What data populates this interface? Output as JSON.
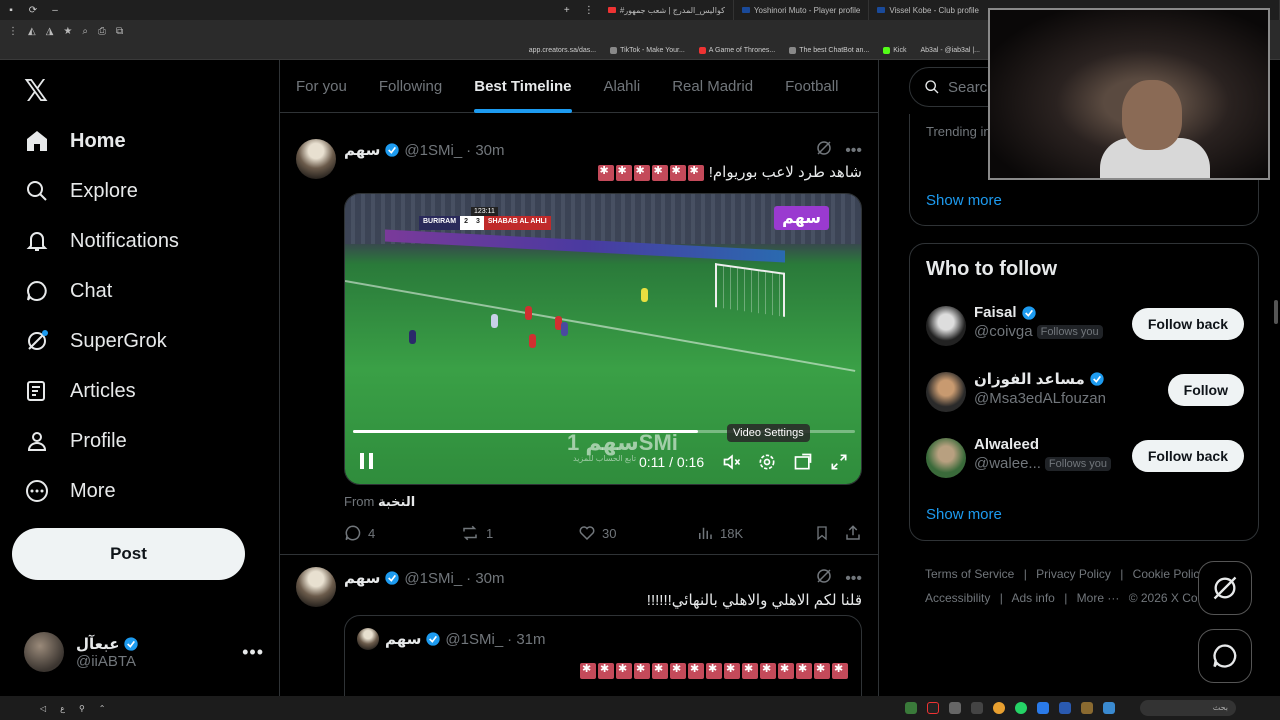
{
  "browser": {
    "tabs": [
      {
        "label": "#كواليس_المدرج | شعب جمهور"
      },
      {
        "label": "Yoshinori Muto - Player profile"
      },
      {
        "label": "Vissel Kobe - Club profile"
      }
    ],
    "bookmarks": [
      {
        "label": "app.creators.sa/das..."
      },
      {
        "label": "TikTok - Make Your..."
      },
      {
        "label": "A Game of Thrones..."
      },
      {
        "label": "The best ChatBot an..."
      },
      {
        "label": "Kick"
      },
      {
        "label": "Ab3al - @iab3al |..."
      }
    ]
  },
  "nav": {
    "items": [
      {
        "label": "Home",
        "icon": "home-icon"
      },
      {
        "label": "Explore",
        "icon": "search-icon"
      },
      {
        "label": "Notifications",
        "icon": "bell-icon"
      },
      {
        "label": "Chat",
        "icon": "chat-icon"
      },
      {
        "label": "SuperGrok",
        "icon": "grok-icon"
      },
      {
        "label": "Articles",
        "icon": "article-icon"
      },
      {
        "label": "Profile",
        "icon": "person-icon"
      },
      {
        "label": "More",
        "icon": "more-circle-icon"
      }
    ],
    "post_label": "Post",
    "account": {
      "name": "عبعآل",
      "handle": "@iiABTA"
    }
  },
  "timeline": {
    "tabs": [
      "For you",
      "Following",
      "Best Timeline",
      "Alahli",
      "Real Madrid",
      "Football"
    ],
    "active_tab": "Best Timeline"
  },
  "tweet1": {
    "name": "سهم",
    "handle": "@1SMi_",
    "time": "· 30m",
    "text": "شاهد طرد لاعب بوريوام!",
    "emoji_count": 6,
    "video": {
      "brand": "سهم",
      "watermark": "سهم 1SMi",
      "watermark_sub": "تابع الحساب للمزيد",
      "score": {
        "team_a": "BURIRAM",
        "score_a": "2",
        "score_b": "3",
        "team_b": "SHABAB AL AHLI",
        "clock": "123:11"
      },
      "progress": 0.6875,
      "time": "0:11 / 0:16",
      "tooltip": "Video Settings"
    },
    "from_prefix": "From",
    "from_source": "النخبة",
    "stats": {
      "replies": "4",
      "reposts": "1",
      "likes": "30",
      "views": "18K"
    }
  },
  "tweet2": {
    "name": "سهم",
    "handle": "@1SMi_",
    "time": "· 30m",
    "text": "قلنا لكم الاهلي والاهلي بالنهائي!!!!!!",
    "quote": {
      "name": "سهم",
      "handle": "@1SMi_",
      "time": "· 31m",
      "emoji_count": 15
    }
  },
  "sidebar": {
    "search_placeholder": "Search",
    "trending_label": "Trending in",
    "show_more": "Show more",
    "who_to_follow_title": "Who to follow",
    "who_to_follow": [
      {
        "name": "Faisal",
        "handle": "@coivga",
        "follows_you": "Follows you",
        "button": "Follow back"
      },
      {
        "name": "مساعد الفوزان",
        "handle": "@Msa3edALfouzan",
        "follows_you": "",
        "button": "Follow"
      },
      {
        "name": "Alwaleed",
        "handle": "@walee...",
        "follows_you": "Follows you",
        "button": "Follow back"
      }
    ],
    "show_more_2": "Show more",
    "footer": [
      "Terms of Service",
      "|",
      "Privacy Policy",
      "|",
      "Cookie Policy",
      "|",
      "Accessibility",
      "|",
      "Ads info",
      "|",
      "More ···",
      "© 2026 X Cor"
    ]
  },
  "taskbar": {
    "search_label": "بحث"
  },
  "colors": {
    "accent": "#1d9bf0",
    "background": "#000000",
    "muted": "#71767b",
    "text": "#e7e9ea"
  }
}
